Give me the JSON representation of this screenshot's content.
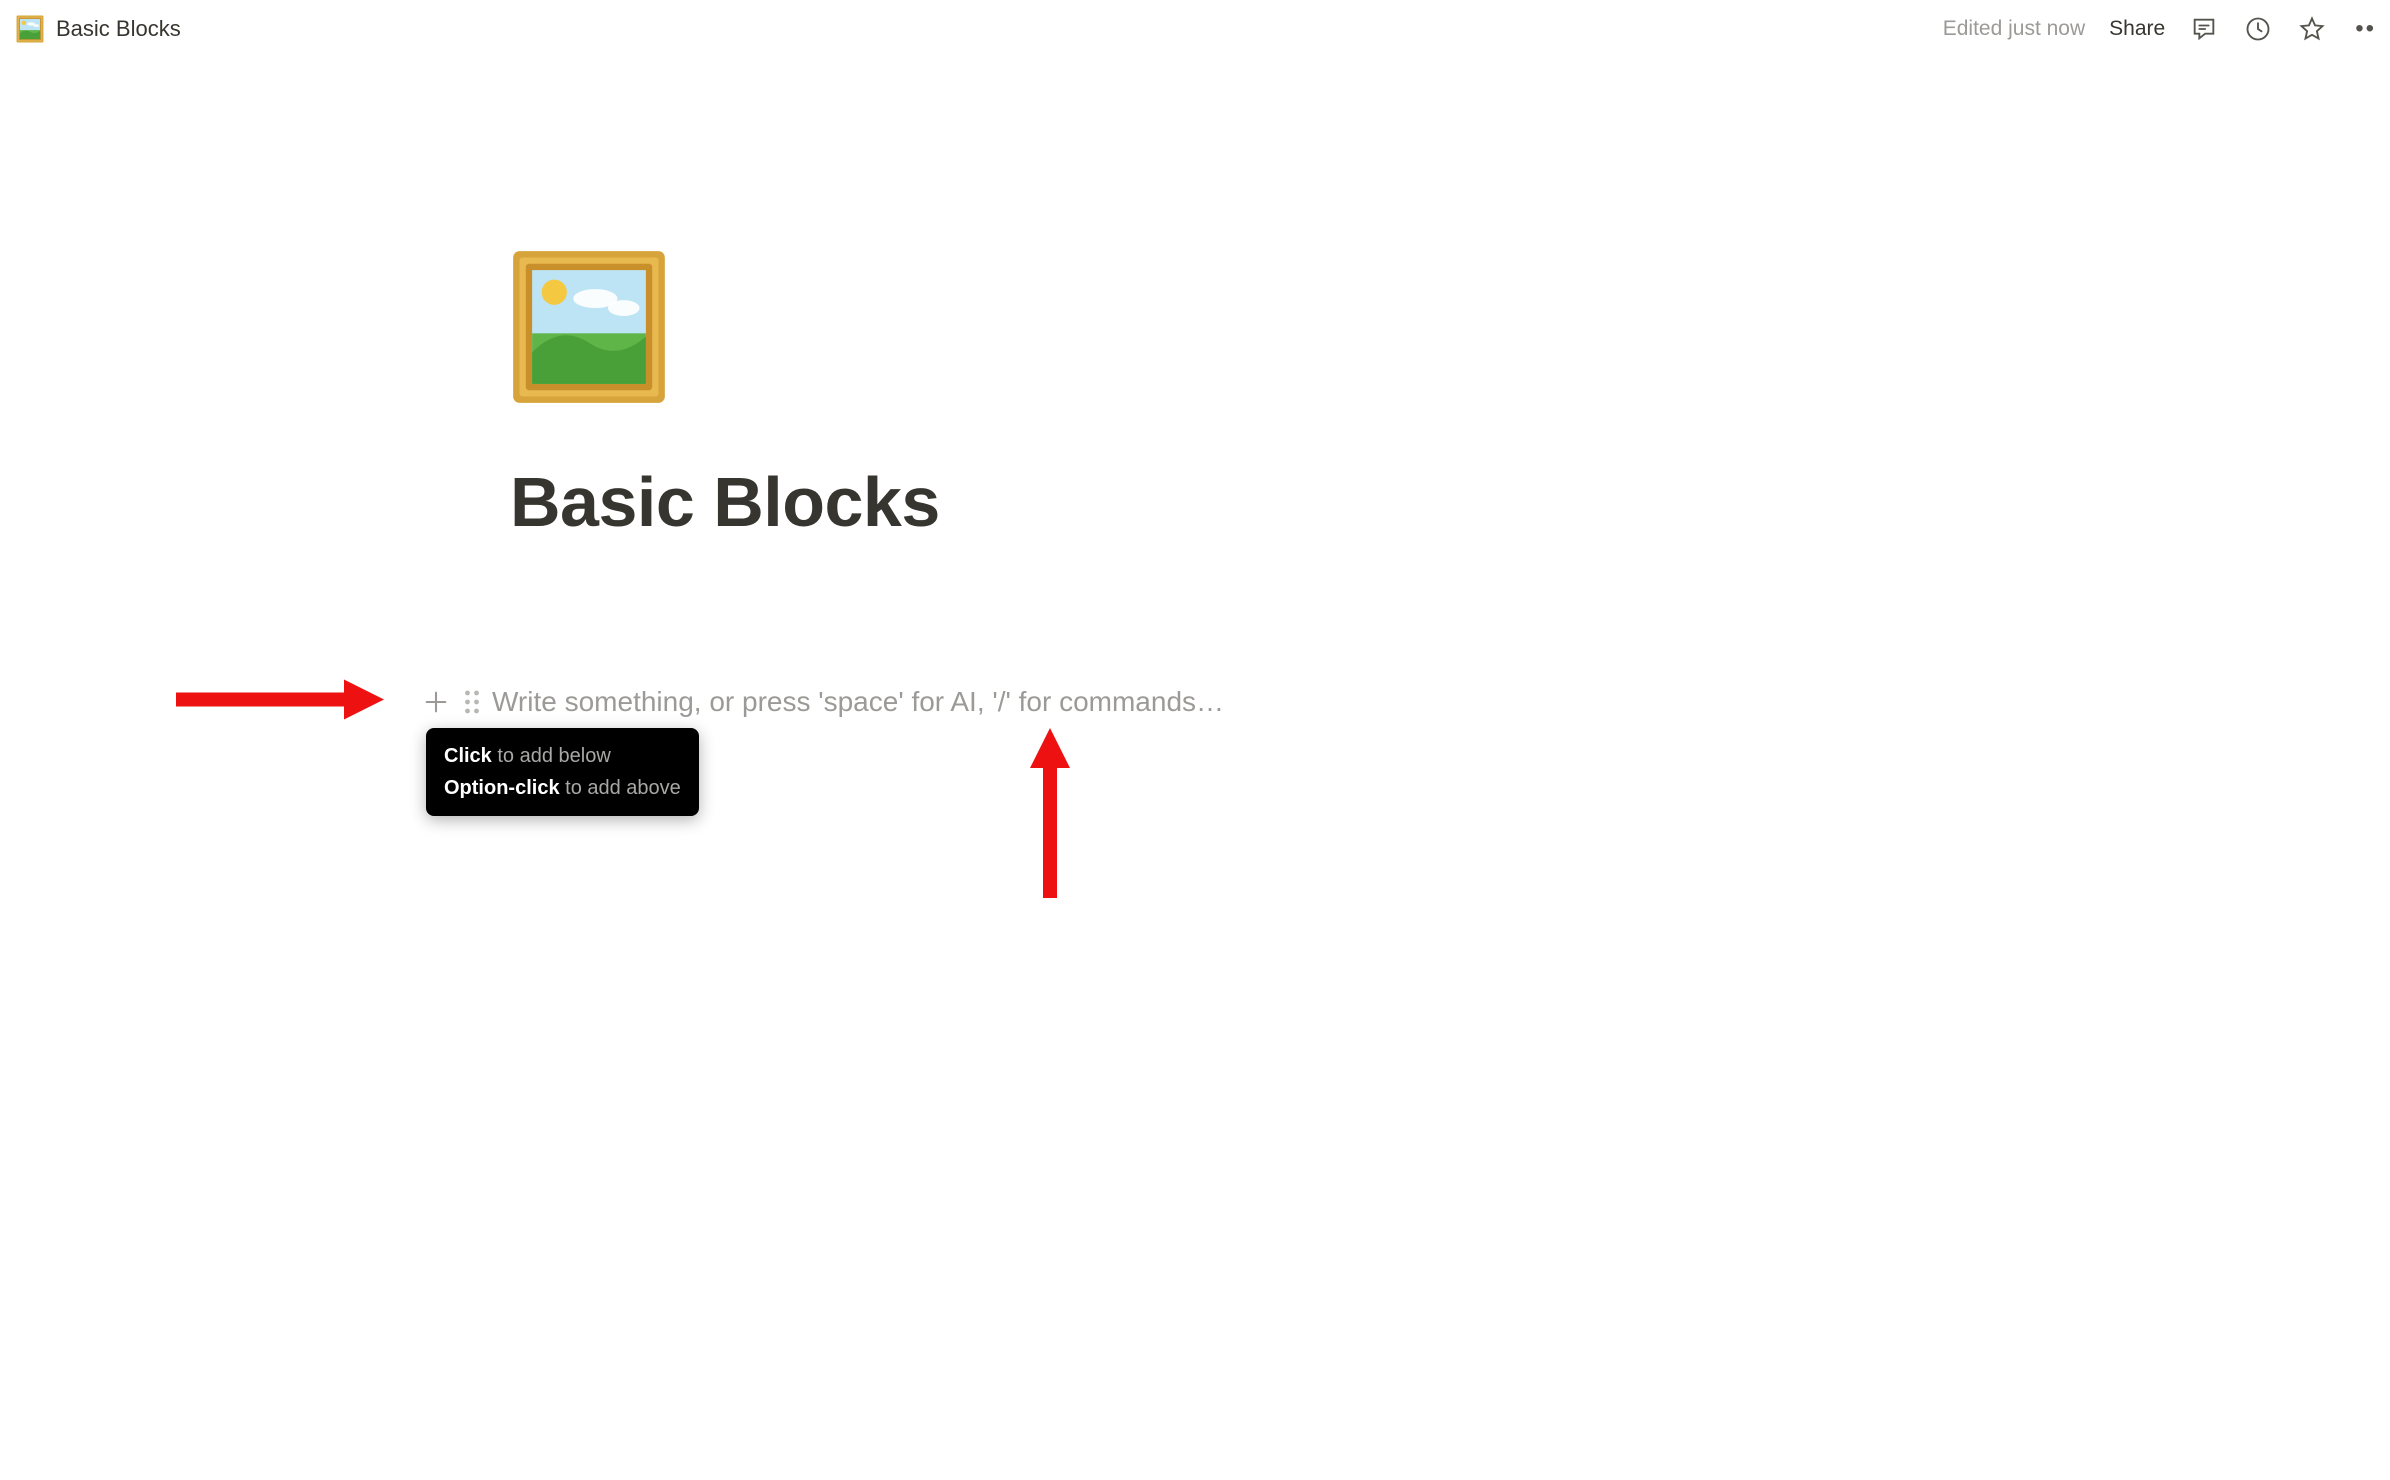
{
  "topbar": {
    "title": "Basic Blocks",
    "edited": "Edited just now",
    "share": "Share"
  },
  "page": {
    "title": "Basic Blocks"
  },
  "block": {
    "placeholder": "Write something, or press 'space' for AI, '/' for commands…"
  },
  "tooltip": {
    "line1_strong": "Click",
    "line1_dim": " to add below",
    "line2_strong": "Option-click",
    "line2_dim": " to add above"
  }
}
